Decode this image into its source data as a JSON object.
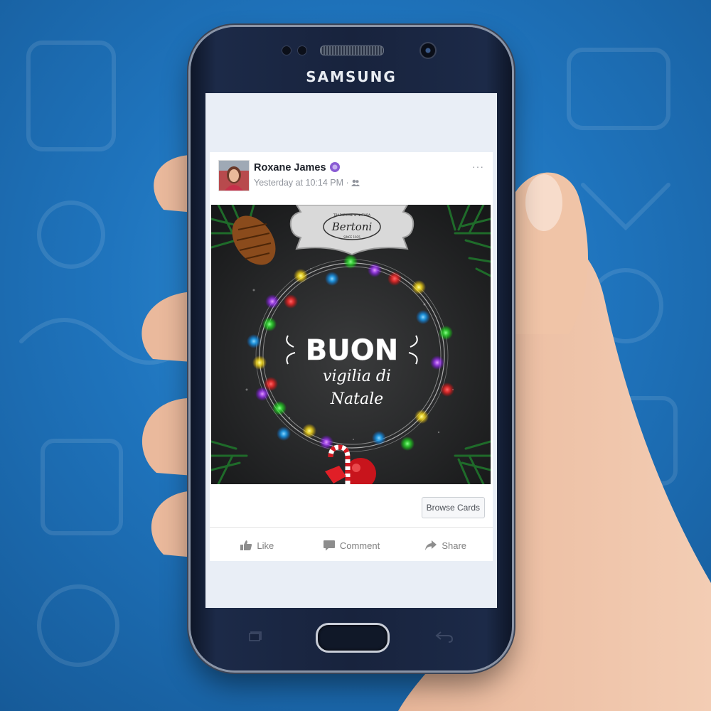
{
  "phone": {
    "brand": "SAMSUNG"
  },
  "post": {
    "author": "Roxane James",
    "timestamp": "Yesterday at 10:14 PM",
    "timestamp_separator": "·",
    "more_label": "···",
    "image": {
      "logo_top": "TRADIZIONE & NATURA",
      "logo_name": "Bertoni",
      "logo_bottom": "SINCE 1935",
      "greeting_line1": "BUON",
      "greeting_line2": "vigilia di",
      "greeting_line3": "Natale"
    },
    "browse_label": "Browse Cards",
    "actions": {
      "like": "Like",
      "comment": "Comment",
      "share": "Share"
    }
  },
  "colors": {
    "facebook_gray": "#90949c",
    "background_blue": "#1f74bd",
    "phone_body": "#18233d"
  },
  "icons": [
    "verified-badge-icon",
    "friends-icon",
    "more-icon",
    "like-icon",
    "comment-icon",
    "share-icon",
    "recent-apps-icon",
    "back-icon"
  ]
}
